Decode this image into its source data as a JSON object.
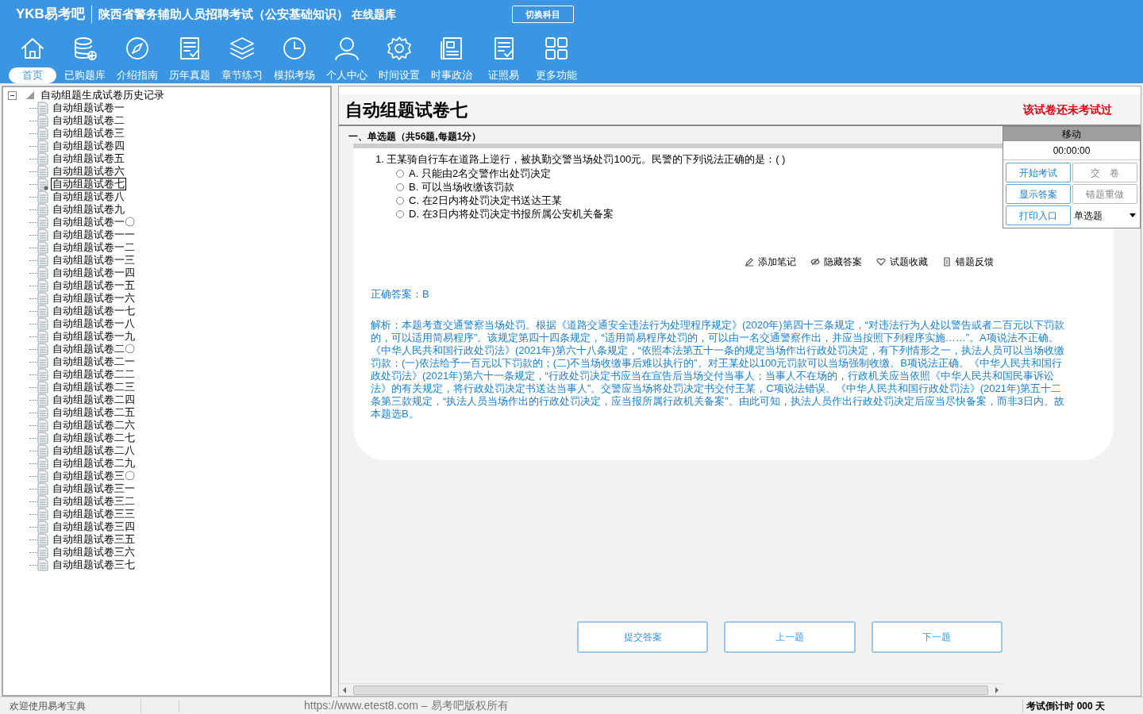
{
  "header": {
    "logo": "YKB易考吧",
    "title": "陕西省警务辅助人员招聘考试（公安基础知识）",
    "subtitle": "在线题库",
    "switch_button": "切换科目"
  },
  "nav": [
    {
      "label": "首页",
      "kind": "home",
      "selected": true
    },
    {
      "label": "已购题库",
      "kind": "database",
      "selected": false
    },
    {
      "label": "介绍指南",
      "kind": "compass",
      "selected": false
    },
    {
      "label": "历年真题",
      "kind": "list",
      "selected": false
    },
    {
      "label": "章节练习",
      "kind": "layers",
      "selected": false
    },
    {
      "label": "模拟考场",
      "kind": "clock",
      "selected": false
    },
    {
      "label": "个人中心",
      "kind": "user",
      "selected": false
    },
    {
      "label": "时间设置",
      "kind": "gear",
      "selected": false
    },
    {
      "label": "时事政治",
      "kind": "news",
      "selected": false
    },
    {
      "label": "证照易",
      "kind": "list",
      "selected": false
    },
    {
      "label": "更多功能",
      "kind": "grid",
      "selected": false
    }
  ],
  "tree": {
    "label": "自动组题生成试卷历史记录",
    "expanded": true,
    "children": [
      {
        "label": "自动组题试卷一",
        "selected": false
      },
      {
        "label": "自动组题试卷二",
        "selected": false
      },
      {
        "label": "自动组题试卷三",
        "selected": false
      },
      {
        "label": "自动组题试卷四",
        "selected": false
      },
      {
        "label": "自动组题试卷五",
        "selected": false
      },
      {
        "label": "自动组题试卷六",
        "selected": false
      },
      {
        "label": "自动组题试卷七",
        "selected": true
      },
      {
        "label": "自动组题试卷八",
        "selected": false
      },
      {
        "label": "自动组题试卷九",
        "selected": false
      },
      {
        "label": "自动组题试卷一〇",
        "selected": false
      },
      {
        "label": "自动组题试卷一一",
        "selected": false
      },
      {
        "label": "自动组题试卷一二",
        "selected": false
      },
      {
        "label": "自动组题试卷一三",
        "selected": false
      },
      {
        "label": "自动组题试卷一四",
        "selected": false
      },
      {
        "label": "自动组题试卷一五",
        "selected": false
      },
      {
        "label": "自动组题试卷一六",
        "selected": false
      },
      {
        "label": "自动组题试卷一七",
        "selected": false
      },
      {
        "label": "自动组题试卷一八",
        "selected": false
      },
      {
        "label": "自动组题试卷一九",
        "selected": false
      },
      {
        "label": "自动组题试卷二〇",
        "selected": false
      },
      {
        "label": "自动组题试卷二一",
        "selected": false
      },
      {
        "label": "自动组题试卷二二",
        "selected": false
      },
      {
        "label": "自动组题试卷二三",
        "selected": false
      },
      {
        "label": "自动组题试卷二四",
        "selected": false
      },
      {
        "label": "自动组题试卷二五",
        "selected": false
      },
      {
        "label": "自动组题试卷二六",
        "selected": false
      },
      {
        "label": "自动组题试卷二七",
        "selected": false
      },
      {
        "label": "自动组题试卷二八",
        "selected": false
      },
      {
        "label": "自动组题试卷二九",
        "selected": false
      },
      {
        "label": "自动组题试卷三〇",
        "selected": false
      },
      {
        "label": "自动组题试卷三一",
        "selected": false
      },
      {
        "label": "自动组题试卷三二",
        "selected": false
      },
      {
        "label": "自动组题试卷三三",
        "selected": false
      },
      {
        "label": "自动组题试卷三四",
        "selected": false
      },
      {
        "label": "自动组题试卷三五",
        "selected": false
      },
      {
        "label": "自动组题试卷三六",
        "selected": false
      },
      {
        "label": "自动组题试卷三七",
        "selected": false
      }
    ]
  },
  "paper": {
    "title": "自动组题试卷七",
    "status": "该试卷还未考试过",
    "section": "一、单选题（共56题,每题1分）"
  },
  "question": {
    "stem": "1. 王某骑自行车在道路上逆行，被执勤交警当场处罚100元。民警的下列说法正确的是：( )",
    "options": [
      {
        "label": "A. 只能由2名交警作出处罚决定",
        "checked": false
      },
      {
        "label": "B. 可以当场收缴该罚款",
        "checked": false
      },
      {
        "label": "C. 在2日内将处罚决定书送达王某",
        "checked": false
      },
      {
        "label": "D. 在3日内将处罚决定书报所属公安机关备案",
        "checked": false
      }
    ],
    "actions": [
      {
        "label": "添加笔记",
        "kind": "pen"
      },
      {
        "label": "隐藏答案",
        "kind": "eye"
      },
      {
        "label": "试题收藏",
        "kind": "heart"
      },
      {
        "label": "错题反馈",
        "kind": "doc"
      }
    ],
    "answer": "正确答案：B",
    "analysis": "解析：本题考查交通警察当场处罚。根据《道路交通安全违法行为处理程序规定》(2020年)第四十三条规定，“对违法行为人处以警告或者二百元以下罚款的，可以适用简易程序”。该规定第四十四条规定，“适用简易程序处罚的，可以由一名交通警察作出，并应当按照下列程序实施……”。A项说法不正确。《中华人民共和国行政处罚法》(2021年)第六十八条规定，“依照本法第五十一条的规定当场作出行政处罚决定，有下列情形之一，执法人员可以当场收缴罚款：(一)依法给予一百元以下罚款的；(二)不当场收缴事后难以执行的”。对王某处以100元罚款可以当场强制收缴。B项说法正确。《中华人民共和国行政处罚法》(2021年)第六十一条规定，“行政处罚决定书应当在宣告后当场交付当事人；当事人不在场的，行政机关应当依照《中华人民共和国民事诉讼法》的有关规定，将行政处罚决定书送达当事人”。交警应当场将处罚决定书交付王某，C项说法错误。《中华人民共和国行政处罚法》(2021年)第五十二条第三款规定，“执法人员当场作出的行政处罚决定，应当报所属行政机关备案”。由此可知，执法人员作出行政处罚决定后应当尽快备案，而非3日内。故本题选B。"
  },
  "control_panel": {
    "title": "移动",
    "timer": "00:00:00",
    "buttons": [
      {
        "label": "开始考试",
        "enabled": true
      },
      {
        "label": "交　卷",
        "enabled": false
      },
      {
        "label": "显示答案",
        "enabled": true
      },
      {
        "label": "错题重做",
        "enabled": false
      },
      {
        "label": "打印入口",
        "enabled": true
      }
    ],
    "type_select": "单选题"
  },
  "bottom_buttons": [
    "提交答案",
    "上一题",
    "下一题"
  ],
  "status_bar": {
    "welcome": "欢迎使用易考宝典",
    "copyright": "https://www.etest8.com – 易考吧版权所有",
    "countdown": "考试倒计时 000 天"
  }
}
